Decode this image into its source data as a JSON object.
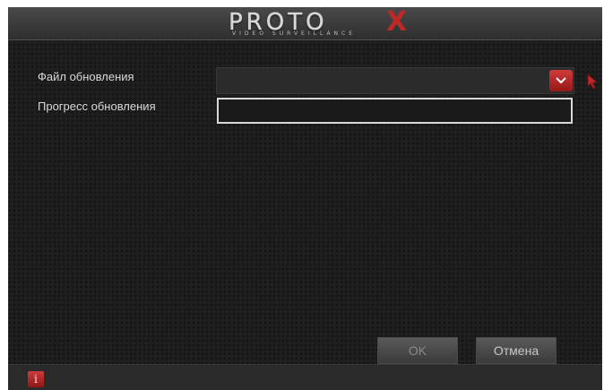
{
  "header": {
    "logo_main": "PROTO",
    "logo_x": "X",
    "logo_sub": "VIDEO SURVEILLANCE"
  },
  "form": {
    "file_label": "Файл обновления",
    "file_value": "",
    "progress_label": "Прогресс обновления",
    "progress_fraction": 0
  },
  "buttons": {
    "ok_label": "OK",
    "cancel_label": "Отмена"
  },
  "footer": {
    "info_glyph": "i"
  },
  "colors": {
    "accent": "#c02828",
    "background": "#1f1f1f",
    "text": "#d8d8d8"
  }
}
